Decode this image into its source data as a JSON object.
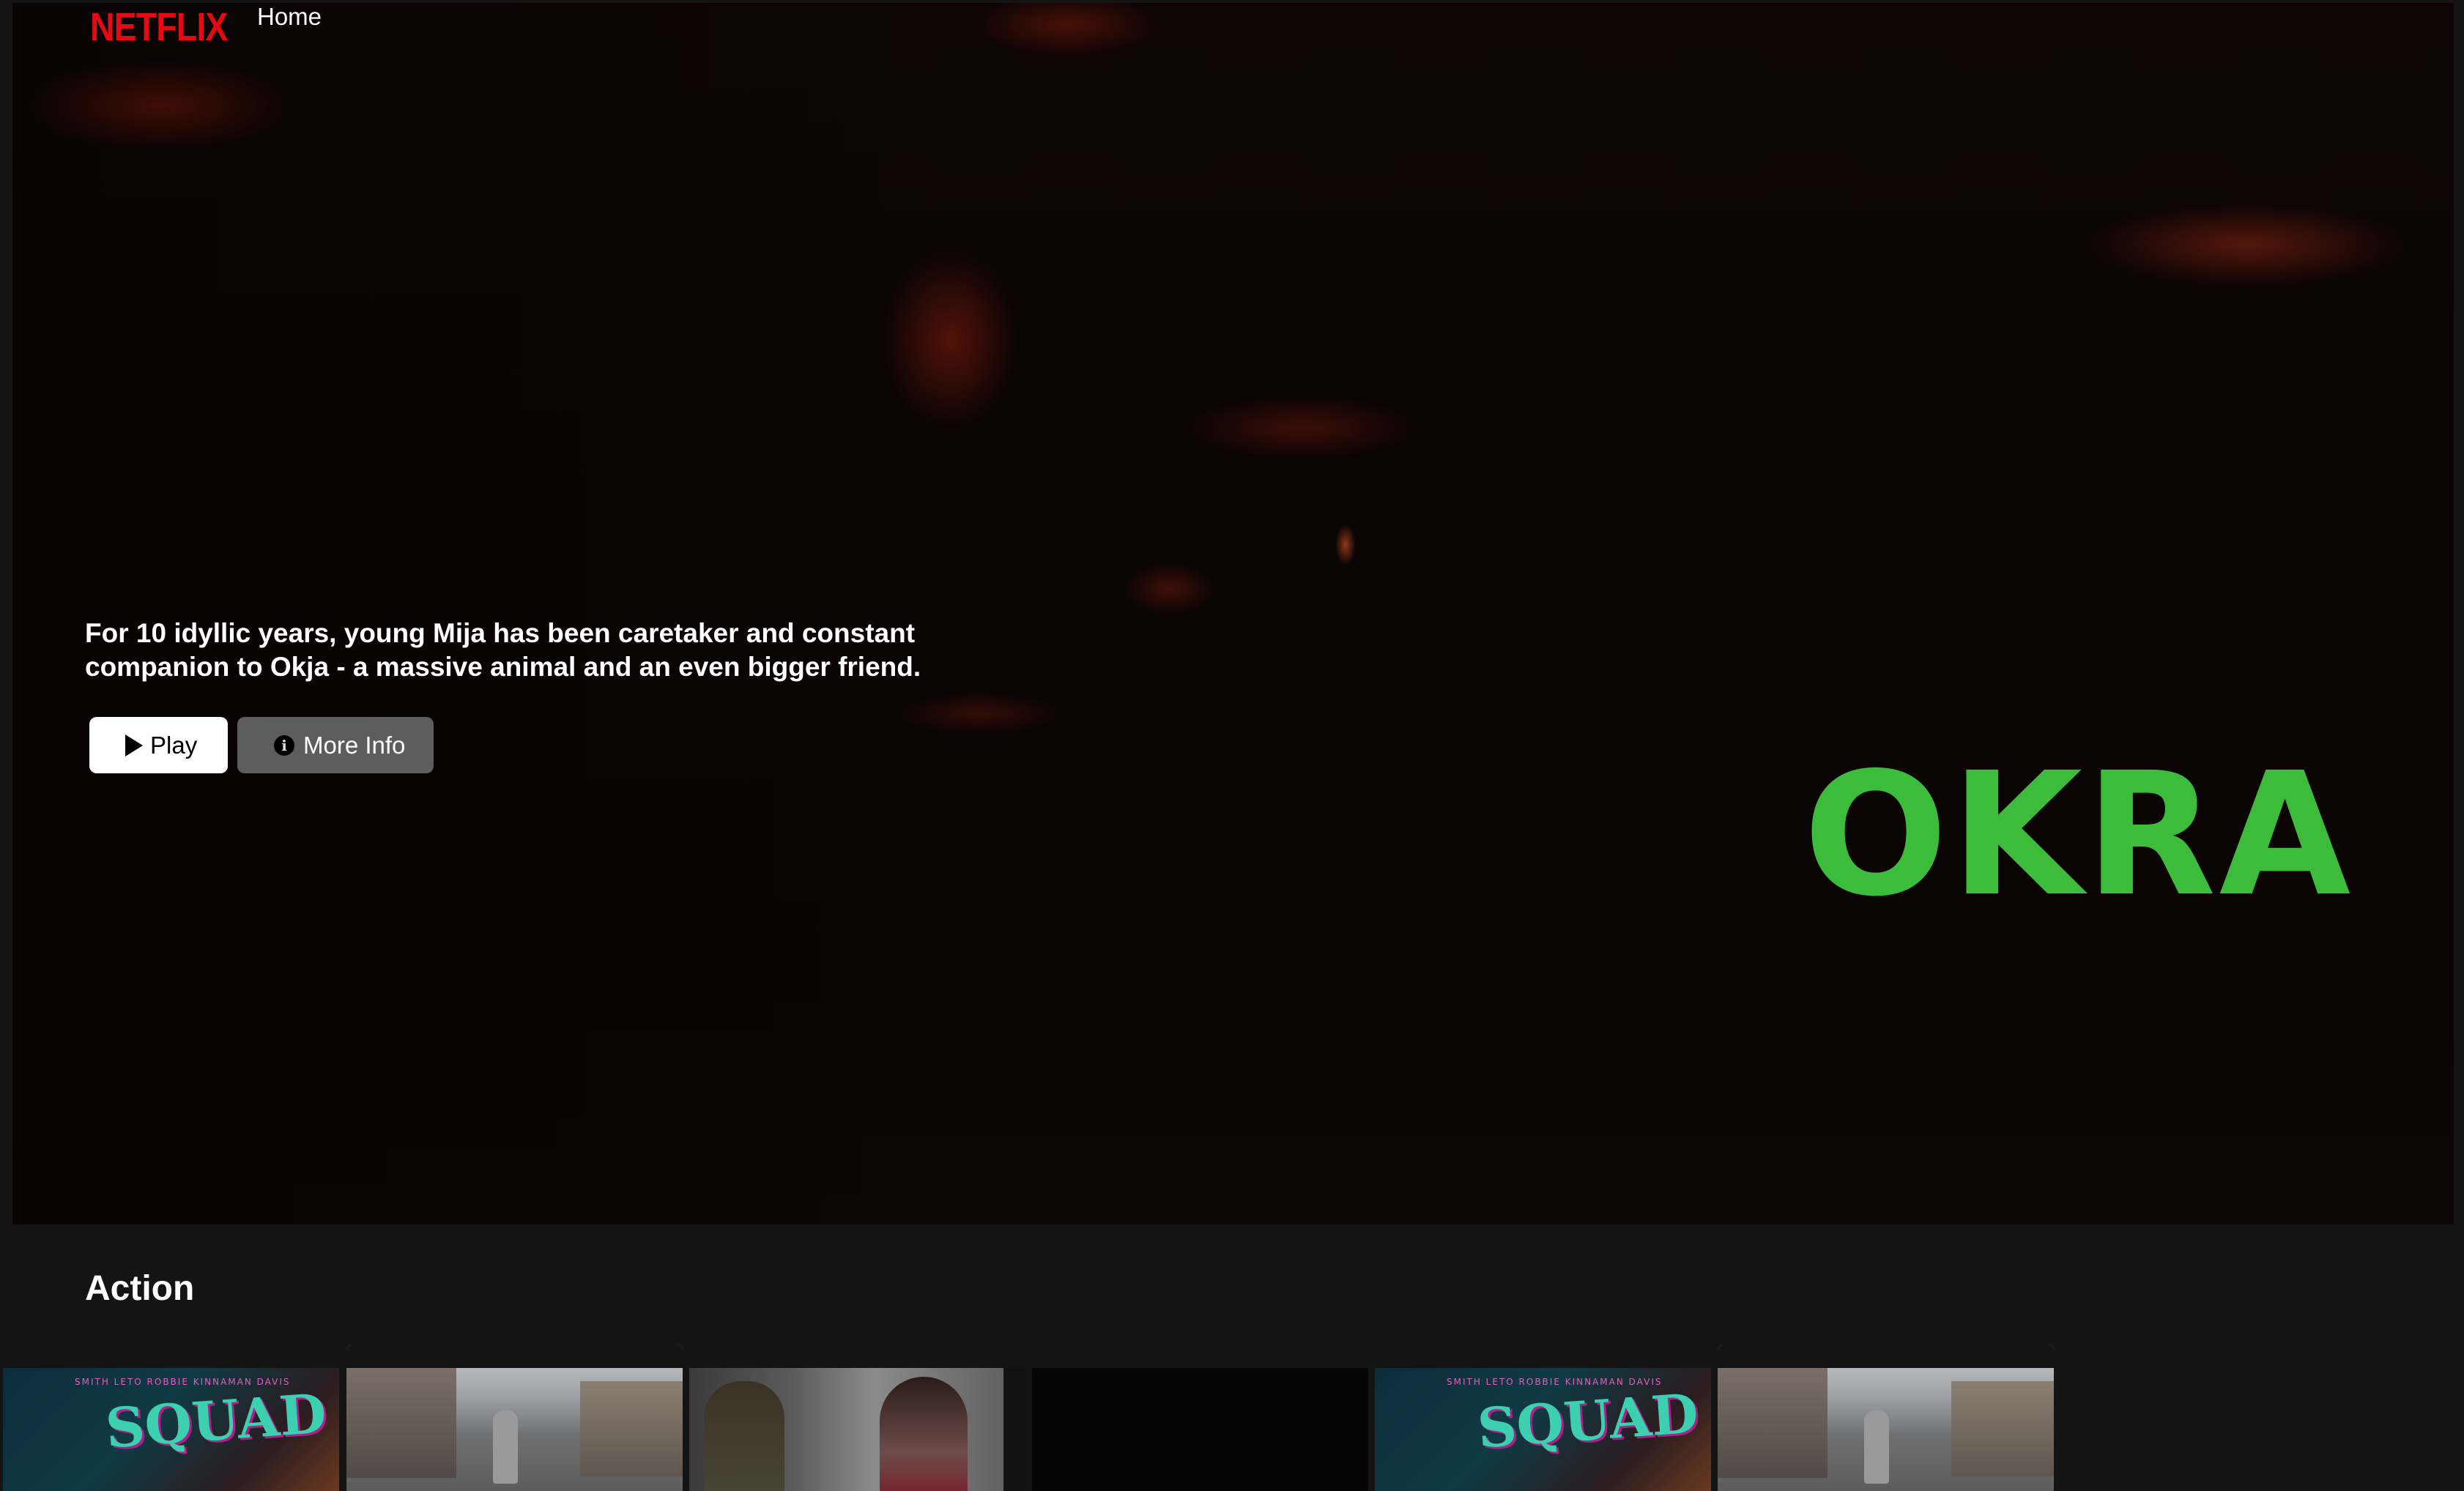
{
  "nav": {
    "logo_text": "NETFLIX",
    "home_label": "Home"
  },
  "hero": {
    "description": "For 10 idyllic years, young Mija has been caretaker and constant companion to Okja - a massive animal and an even bigger friend.",
    "play_label": "Play",
    "more_info_label": "More Info",
    "title_card": "OKRA"
  },
  "rows": [
    {
      "title": "Action",
      "tiles": [
        {
          "kind": "suicide-squad-poster",
          "credits": "SMITH  LETO  ROBBIE  KINNAMAN  DAVIS",
          "logo": "SUICIDE SQUAD"
        },
        {
          "kind": "street-scene"
        },
        {
          "kind": "soldiers-scene"
        },
        {
          "kind": "blank"
        },
        {
          "kind": "suicide-squad-poster",
          "credits": "SMITH  LETO  ROBBIE  KINNAMAN  DAVIS",
          "logo": "SUICIDE SQUAD"
        },
        {
          "kind": "street-scene"
        }
      ]
    }
  ],
  "colors": {
    "brand_red": "#e50914",
    "title_green": "#3dbb3a",
    "background": "#141414"
  },
  "icons": {
    "play": "play-icon",
    "info": "info-icon"
  }
}
